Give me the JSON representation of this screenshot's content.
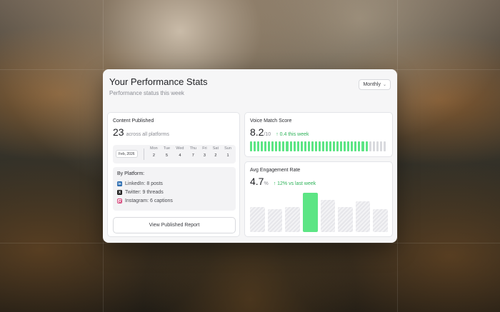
{
  "card": {
    "title": "Your Performance Stats",
    "subtitle": "Performance status this week",
    "period_select": "Monthly"
  },
  "content_published": {
    "label": "Content Published",
    "value": "23",
    "suffix": "across all platforms",
    "date_pill": "Feb, 2026",
    "days": [
      {
        "name": "Mon",
        "value": "2"
      },
      {
        "name": "Tue",
        "value": "5"
      },
      {
        "name": "Wed",
        "value": "4"
      },
      {
        "name": "Thu",
        "value": "7"
      },
      {
        "name": "Fri",
        "value": "3"
      },
      {
        "name": "Sat",
        "value": "2"
      },
      {
        "name": "Sun",
        "value": "1"
      }
    ],
    "by_platform_title": "By Platform:",
    "platforms": [
      {
        "icon": "linkedin-icon",
        "label": "LinkedIn: 8 posts"
      },
      {
        "icon": "x-twitter-icon",
        "label": "Twitter: 9 threads"
      },
      {
        "icon": "instagram-icon",
        "label": "Instagram: 6 captions"
      }
    ],
    "report_button": "View Published Report"
  },
  "voice_match": {
    "label": "Voice Match Score",
    "value": "8.2",
    "denominator": "/10",
    "delta": "↑ 0.4 this week",
    "segments_total": 38,
    "segments_filled": 33
  },
  "engagement": {
    "label": "Avg Engagement Rate",
    "value": "4.7",
    "unit": "%",
    "delta": "↑ 12% vs last week",
    "bars": [
      0.6,
      0.55,
      0.6,
      0.95,
      0.78,
      0.6,
      0.75,
      0.55
    ],
    "active_index": 3
  },
  "colors": {
    "accent_green": "#5ce584",
    "delta_green": "#2fb35a",
    "segment_empty": "#d9dade"
  }
}
